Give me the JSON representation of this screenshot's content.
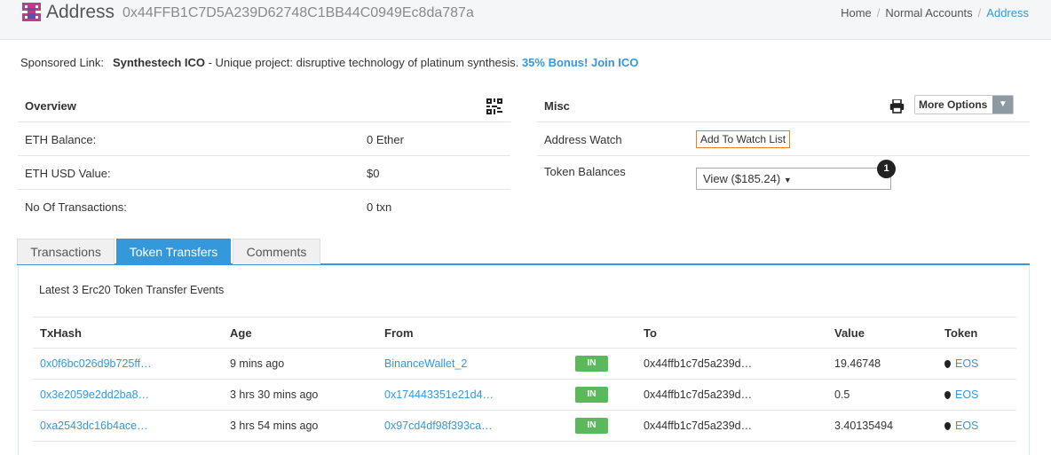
{
  "header": {
    "title": "Address",
    "address": "0x44FFB1C7D5A239D62748C1BB44C0949Ec8da787a",
    "breadcrumb": [
      "Home",
      "Normal Accounts",
      "Address"
    ]
  },
  "sponsored": {
    "label": "Sponsored Link:",
    "name": "Synthestech ICO",
    "text": " - Unique project: disruptive technology of platinum synthesis. ",
    "link": "35% Bonus! Join ICO"
  },
  "overview": {
    "title": "Overview",
    "rows": [
      {
        "label": "ETH Balance:",
        "value": "0 Ether"
      },
      {
        "label": "ETH USD Value:",
        "value": "$0"
      },
      {
        "label": "No Of Transactions:",
        "value": "0 txn"
      }
    ]
  },
  "misc": {
    "title": "Misc",
    "more_options": "More Options",
    "address_watch_label": "Address Watch",
    "add_watch": "Add To Watch List",
    "token_balances_label": "Token Balances",
    "token_balances_select": "View ($185.24)",
    "badge": "1"
  },
  "tabs": [
    "Transactions",
    "Token Transfers",
    "Comments"
  ],
  "transfers": {
    "summary": "Latest 3 Erc20 Token Transfer Events",
    "headers": [
      "TxHash",
      "Age",
      "From",
      "",
      "To",
      "Value",
      "Token"
    ],
    "rows": [
      {
        "hash": "0x0f6bc026d9b725ff…",
        "age": "9 mins ago",
        "from": "BinanceWallet_2",
        "dir": "IN",
        "to": "0x44ffb1c7d5a239d…",
        "value": "19.46748",
        "token": "EOS"
      },
      {
        "hash": "0x3e2059e2dd2ba8…",
        "age": "3 hrs 30 mins ago",
        "from": "0x174443351e21d4…",
        "dir": "IN",
        "to": "0x44ffb1c7d5a239d…",
        "value": "0.5",
        "token": "EOS"
      },
      {
        "hash": "0xa2543dc16b4ace…",
        "age": "3 hrs 54 mins ago",
        "from": "0x97cd4df98f393ca…",
        "dir": "IN",
        "to": "0x44ffb1c7d5a239d…",
        "value": "3.40135494",
        "token": "EOS"
      }
    ]
  }
}
